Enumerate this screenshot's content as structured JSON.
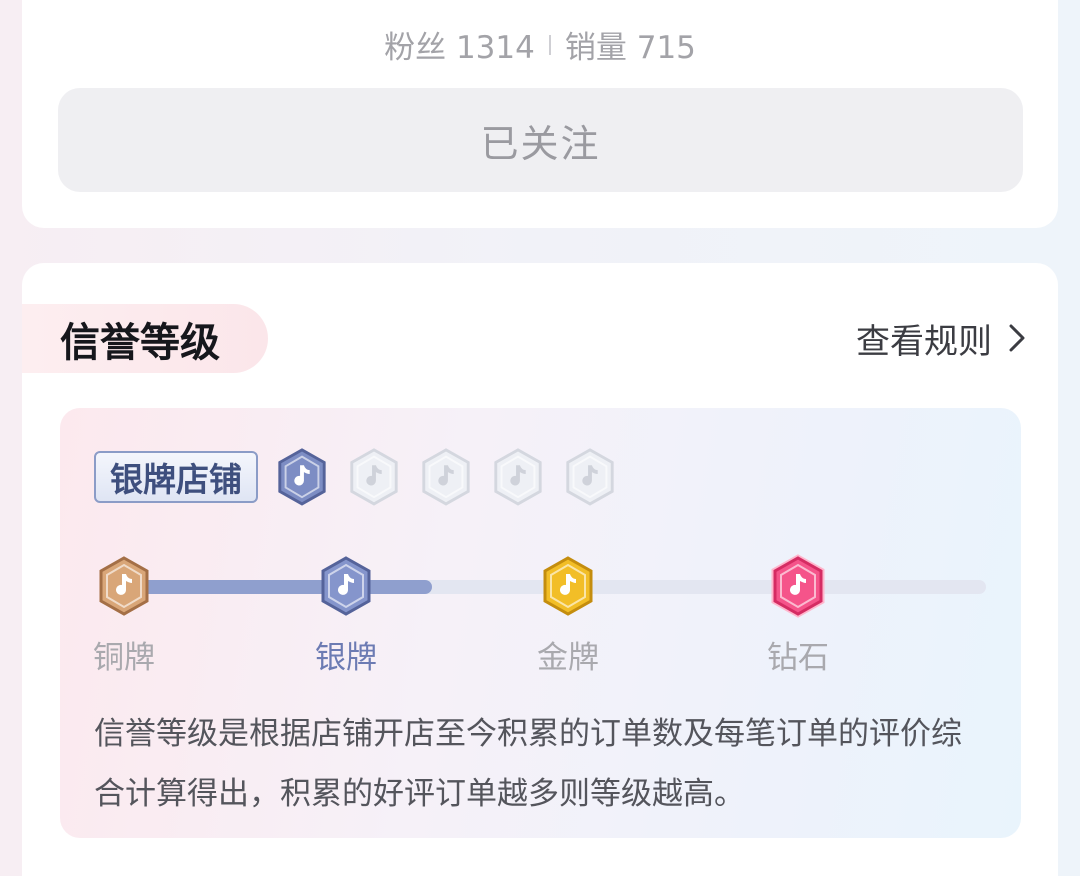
{
  "shop": {
    "fans_label": "粉丝",
    "fans_count": "1314",
    "sales_label": "销量",
    "sales_count": "715",
    "follow_button": "已关注"
  },
  "credit": {
    "title": "信誉等级",
    "rules_link": "查看规则",
    "current_badge": "银牌店铺",
    "current_sub_level": 1,
    "sub_level_total": 5,
    "progress_fraction": 0.36,
    "levels": [
      {
        "label": "铜牌",
        "color": "#c99464"
      },
      {
        "label": "银牌",
        "color": "#7f8fc8"
      },
      {
        "label": "金牌",
        "color": "#e8b21c"
      },
      {
        "label": "钻石",
        "color": "#f0487a"
      }
    ],
    "current_level_index": 1,
    "description": "信誉等级是根据店铺开店至今积累的订单数及每笔订单的评价综合计算得出，积累的好评订单越多则等级越高。"
  },
  "icons": {
    "chevron": "chevron-right-icon",
    "badge": "tiktok-hex-icon"
  }
}
